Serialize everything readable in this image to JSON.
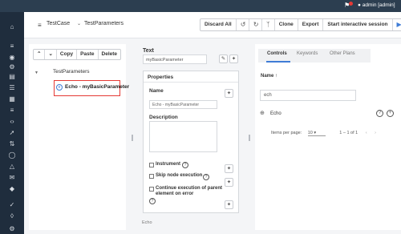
{
  "topbar": {
    "bell_icon": "bell-icon",
    "user": "admin [admin]"
  },
  "sidebar": {
    "icons": [
      "home-icon",
      "menu-icon",
      "globe-icon",
      "settings-icon",
      "file-icon",
      "list-icon",
      "book-icon",
      "list-icon",
      "code-icon",
      "rocket-icon",
      "tune-icon",
      "link-icon",
      "warning-icon",
      "mail-icon",
      "puzzle-icon",
      "check-icon",
      "tag-icon",
      "settings-icon"
    ]
  },
  "header": {
    "type_select": "TestCase",
    "case_name": "TestParameters",
    "discard_label": "Discard All",
    "clone_label": "Clone",
    "export_label": "Export",
    "start_label": "Start interactive session"
  },
  "tree": {
    "copy": "Copy",
    "paste": "Paste",
    "delete": "Delete",
    "root": "TestParameters",
    "selected": "Echo - myBasicParameter"
  },
  "props": {
    "text_label": "Text",
    "text_value": "myBasicParameter",
    "title": "Properties",
    "name_label": "Name",
    "name_value": "Echo - myBasicParameter",
    "description_label": "Description",
    "instrument_label": "Instrument",
    "skip_label": "Skip node execution",
    "continue_label": "Continue execution of parent element on error",
    "footer_type": "Echo"
  },
  "right": {
    "tabs": [
      "Controls",
      "Keywords",
      "Other Plans"
    ],
    "column_name": "Name",
    "sort_icon": "arrow-up-icon",
    "search_value": "ech",
    "result": "Echo",
    "items_per_page_label": "Items per page:",
    "items_per_page": "10",
    "range": "1 – 1 of 1"
  }
}
